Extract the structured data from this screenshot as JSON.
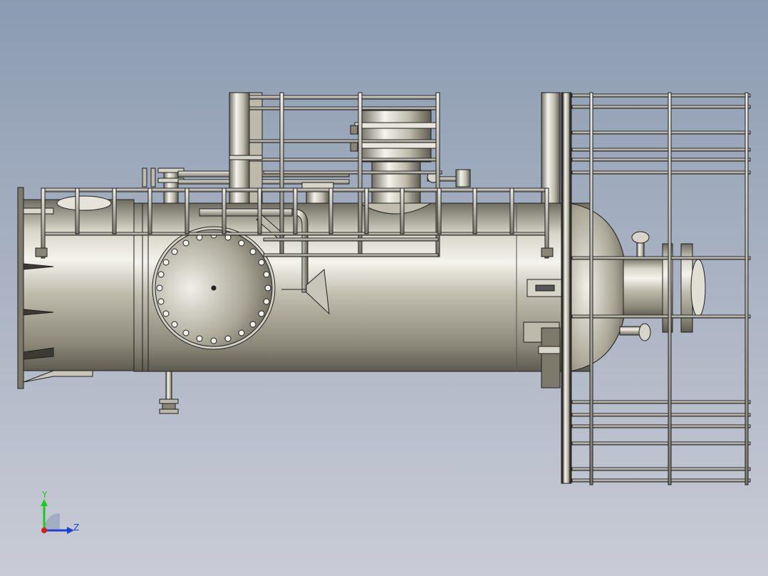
{
  "viewport": {
    "background_top": "#8b9bb1",
    "background_bottom": "#c9ccd6",
    "model_fill": "#9d9a8c",
    "model_stroke": "#1f1f1f",
    "model_highlight": "#f2f1ea"
  },
  "triad": {
    "y_label": "Y",
    "z_label": "Z",
    "y_color": "#1fc81f",
    "z_color": "#1f3fd6",
    "x_color": "#d61f1f"
  }
}
